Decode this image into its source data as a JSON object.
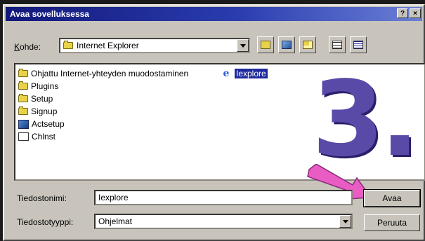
{
  "window": {
    "title": "Avaa sovelluksessa",
    "help_button": "?",
    "close_button": "×"
  },
  "look_in": {
    "label_accel": "K",
    "label_rest": "ohde:",
    "value": "Internet Explorer"
  },
  "toolbar": {
    "icons": [
      "up-folder-icon",
      "desktop-icon",
      "new-folder-icon",
      "list-view-icon",
      "details-view-icon"
    ]
  },
  "files": {
    "column1": [
      {
        "name": "Ohjattu Internet-yhteyden muodostaminen",
        "icon": "folder-icon"
      },
      {
        "name": "Plugins",
        "icon": "folder-icon"
      },
      {
        "name": "Setup",
        "icon": "folder-icon"
      },
      {
        "name": "Signup",
        "icon": "folder-icon"
      },
      {
        "name": "Actsetup",
        "icon": "app-icon"
      },
      {
        "name": "Chlnst",
        "icon": "document-icon"
      }
    ],
    "column2": [
      {
        "name": "Iexplore",
        "icon": "internet-explorer-icon",
        "selected": true
      }
    ]
  },
  "overlay": {
    "step_number": "3.",
    "step_color": "#5a4aa8",
    "arrow_color": "#e85cc4"
  },
  "filename": {
    "label_pre": "Tiedostonimi",
    "label_accel": "",
    "label_display": "Tiedostonimi:",
    "value": "Iexplore"
  },
  "filetype": {
    "label_display": "Tiedostotyyppi:",
    "value": "Ohjelmat"
  },
  "buttons": {
    "open": "Avaa",
    "cancel": "Peruuta"
  },
  "colors": {
    "titlebar": "#12187a",
    "selection": "#1e2a9c",
    "dialog_bg": "#c8c4bc"
  }
}
